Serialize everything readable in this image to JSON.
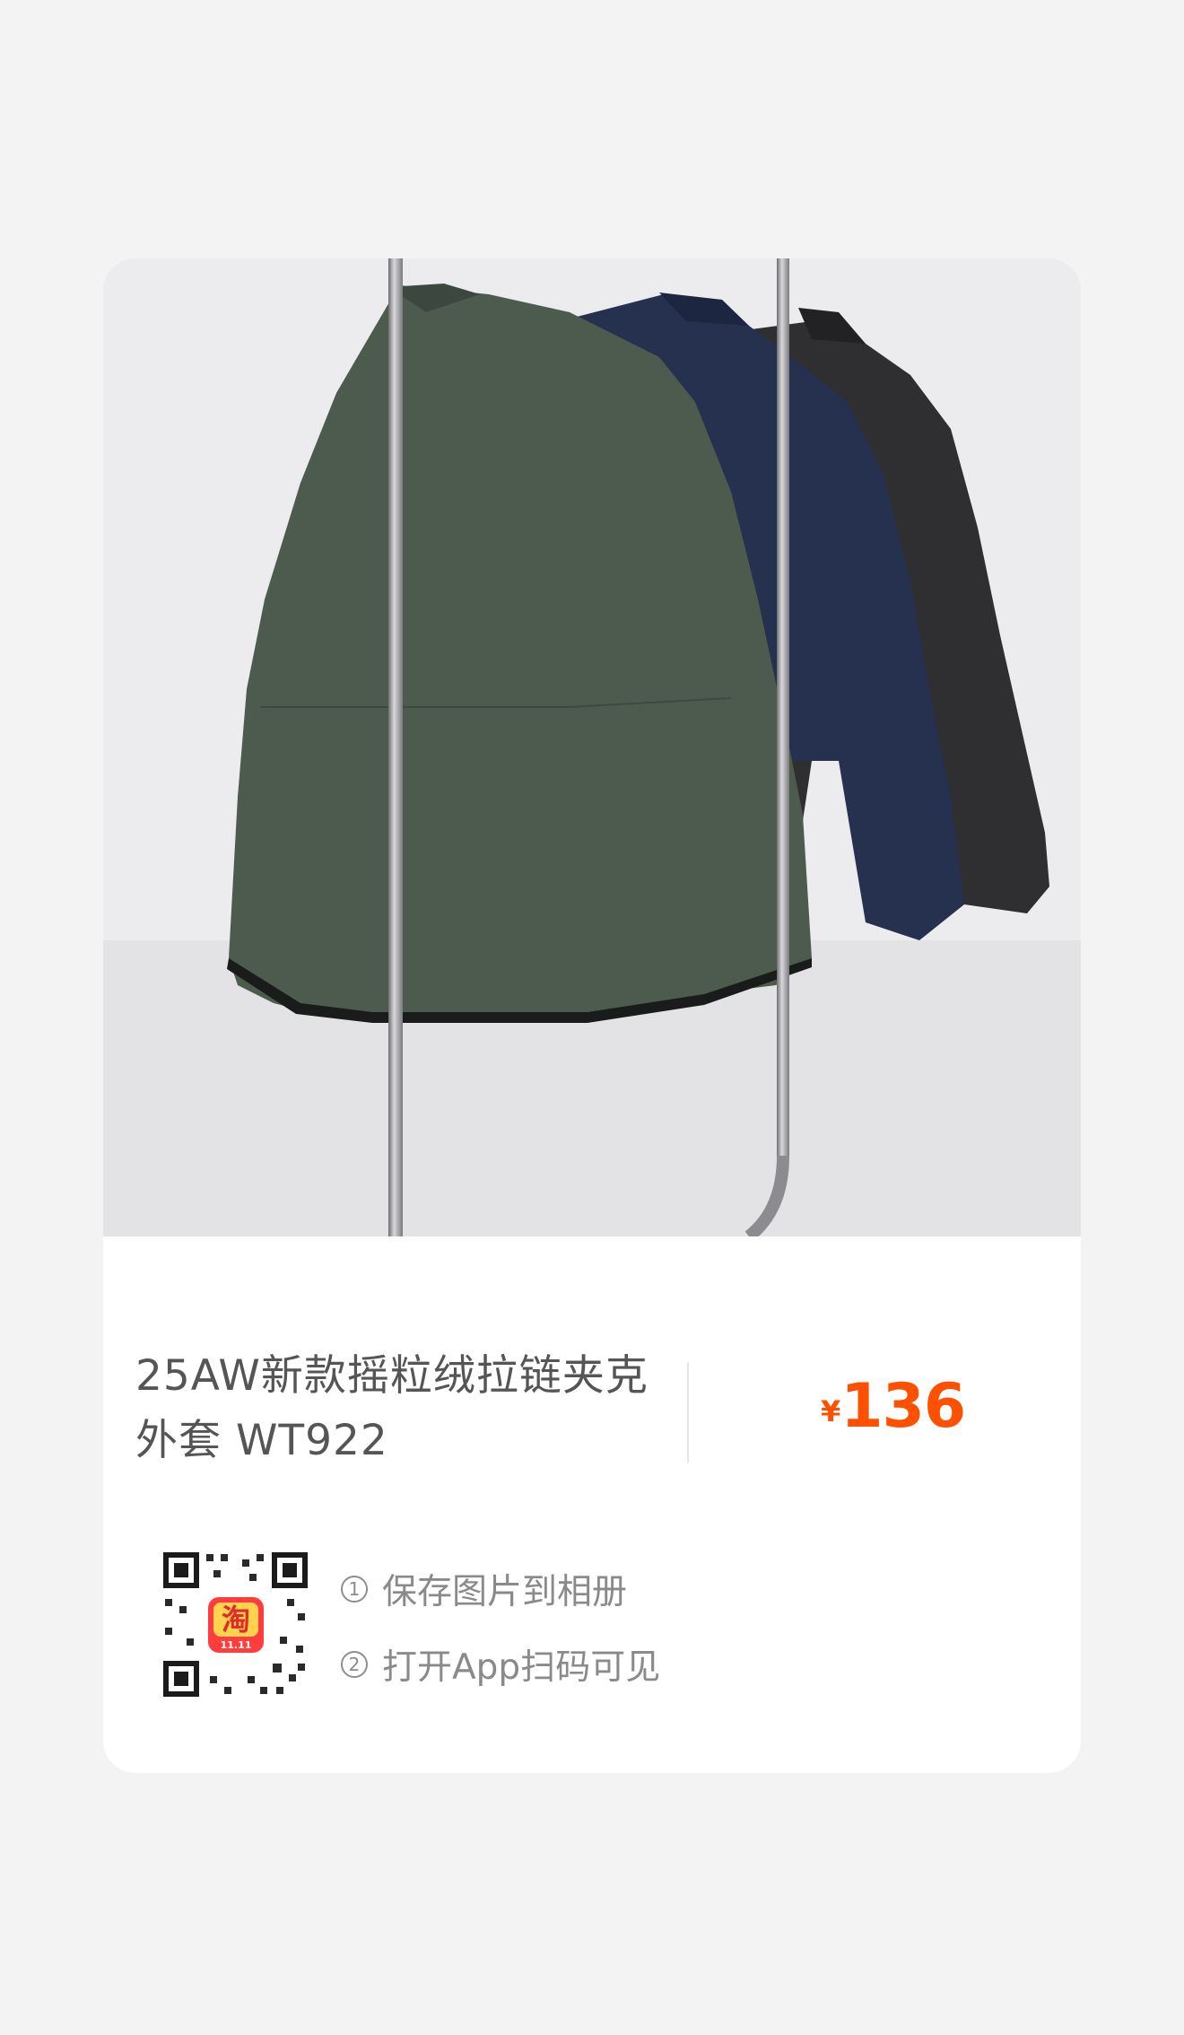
{
  "product": {
    "title_line1": "25AW新款摇粒绒拉链夹克",
    "title_line2": "外套 WT922",
    "currency": "¥",
    "price": "136",
    "price_color": "#ff5000"
  },
  "qr": {
    "badge_glyph": "淘",
    "badge_caption": "11.11"
  },
  "steps": [
    {
      "no": "1",
      "text": "保存图片到相册"
    },
    {
      "no": "2",
      "text": "打开App扫码可见"
    }
  ],
  "brand": {
    "logo_glyph": "淘",
    "color": "#ff5000"
  },
  "icons": {
    "photo": "product-photo",
    "qr": "qr-code",
    "logo": "taobao-logo"
  }
}
